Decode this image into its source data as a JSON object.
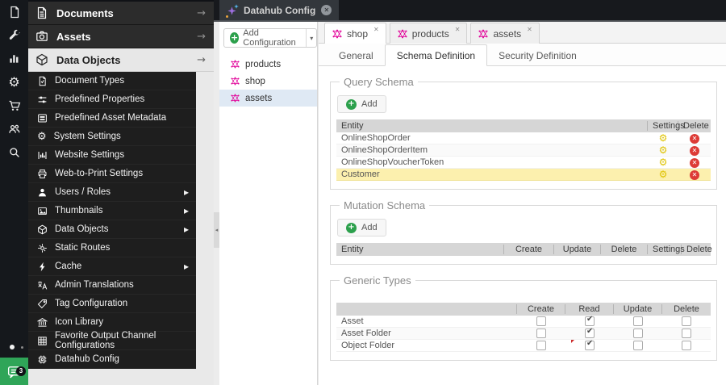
{
  "glyphs": {
    "arrow_right": "→",
    "caret_down": "▾",
    "collapse_left": "◂",
    "close_x": "✕",
    "plus": "+",
    "gear_yellow": "⚙",
    "gear_white": "⚙",
    "submenu_arrow": "▸"
  },
  "colors": {
    "graphql_magenta": "#e10098",
    "add_green": "#2ca04c",
    "settings_yellow": "#dfc303",
    "delete_red": "#dd3b36",
    "row_highlight": "#fcf0ae",
    "tree_selection": "#dfe9f4"
  },
  "icon_strip": {
    "icons": [
      "document",
      "tools",
      "reports",
      "settings",
      "ecommerce",
      "customers",
      "search"
    ],
    "chat_badge": "3"
  },
  "sidebar": {
    "accordion": [
      {
        "label": "Documents",
        "active": false
      },
      {
        "label": "Assets",
        "active": false
      },
      {
        "label": "Data Objects",
        "active": true
      }
    ],
    "items": [
      {
        "label": "Document Types",
        "has_submenu": false
      },
      {
        "label": "Predefined Properties",
        "has_submenu": false
      },
      {
        "label": "Predefined Asset Metadata",
        "has_submenu": false
      },
      {
        "label": "System Settings",
        "has_submenu": false
      },
      {
        "label": "Website Settings",
        "has_submenu": false
      },
      {
        "label": "Web-to-Print Settings",
        "has_submenu": false
      },
      {
        "label": "Users / Roles",
        "has_submenu": true
      },
      {
        "label": "Thumbnails",
        "has_submenu": true
      },
      {
        "label": "Data Objects",
        "has_submenu": true
      },
      {
        "label": "Static Routes",
        "has_submenu": false
      },
      {
        "label": "Cache",
        "has_submenu": true
      },
      {
        "label": "Admin Translations",
        "has_submenu": false
      },
      {
        "label": "Tag Configuration",
        "has_submenu": false
      },
      {
        "label": "Icon Library",
        "has_submenu": false
      },
      {
        "label": "Favorite Output Channel Configurations",
        "has_submenu": false
      },
      {
        "label": "Datahub Config",
        "has_submenu": false
      }
    ]
  },
  "topbar": {
    "tab_label": "Datahub Config"
  },
  "config_panel": {
    "add_label": "Add Configuration",
    "items": [
      {
        "label": "products",
        "selected": false
      },
      {
        "label": "shop",
        "selected": false
      },
      {
        "label": "assets",
        "selected": true
      }
    ]
  },
  "main": {
    "tabs": [
      {
        "label": "shop",
        "active": true
      },
      {
        "label": "products",
        "active": false
      },
      {
        "label": "assets",
        "active": false
      }
    ],
    "subtabs": [
      {
        "label": "General",
        "active": false
      },
      {
        "label": "Schema Definition",
        "active": true
      },
      {
        "label": "Security Definition",
        "active": false
      }
    ],
    "query_schema": {
      "legend": "Query Schema",
      "add_label": "Add",
      "columns": [
        "Entity",
        "Settings",
        "Delete"
      ],
      "rows": [
        {
          "entity": "OnlineShopOrder",
          "highlighted": false
        },
        {
          "entity": "OnlineShopOrderItem",
          "highlighted": false
        },
        {
          "entity": "OnlineShopVoucherToken",
          "highlighted": false
        },
        {
          "entity": "Customer",
          "highlighted": true
        }
      ]
    },
    "mutation_schema": {
      "legend": "Mutation Schema",
      "add_label": "Add",
      "columns": [
        "Entity",
        "Create",
        "Update",
        "Delete",
        "Settings",
        "Delete"
      ],
      "rows": []
    },
    "generic_types": {
      "legend": "Generic Types",
      "columns": [
        "",
        "Create",
        "Read",
        "Update",
        "Delete"
      ],
      "rows": [
        {
          "label": "Asset",
          "create": false,
          "read": true,
          "update": false,
          "delete": false,
          "dirty": false
        },
        {
          "label": "Asset Folder",
          "create": false,
          "read": true,
          "update": false,
          "delete": false,
          "dirty": false
        },
        {
          "label": "Object Folder",
          "create": false,
          "read": true,
          "update": false,
          "delete": false,
          "dirty": true
        }
      ]
    }
  }
}
